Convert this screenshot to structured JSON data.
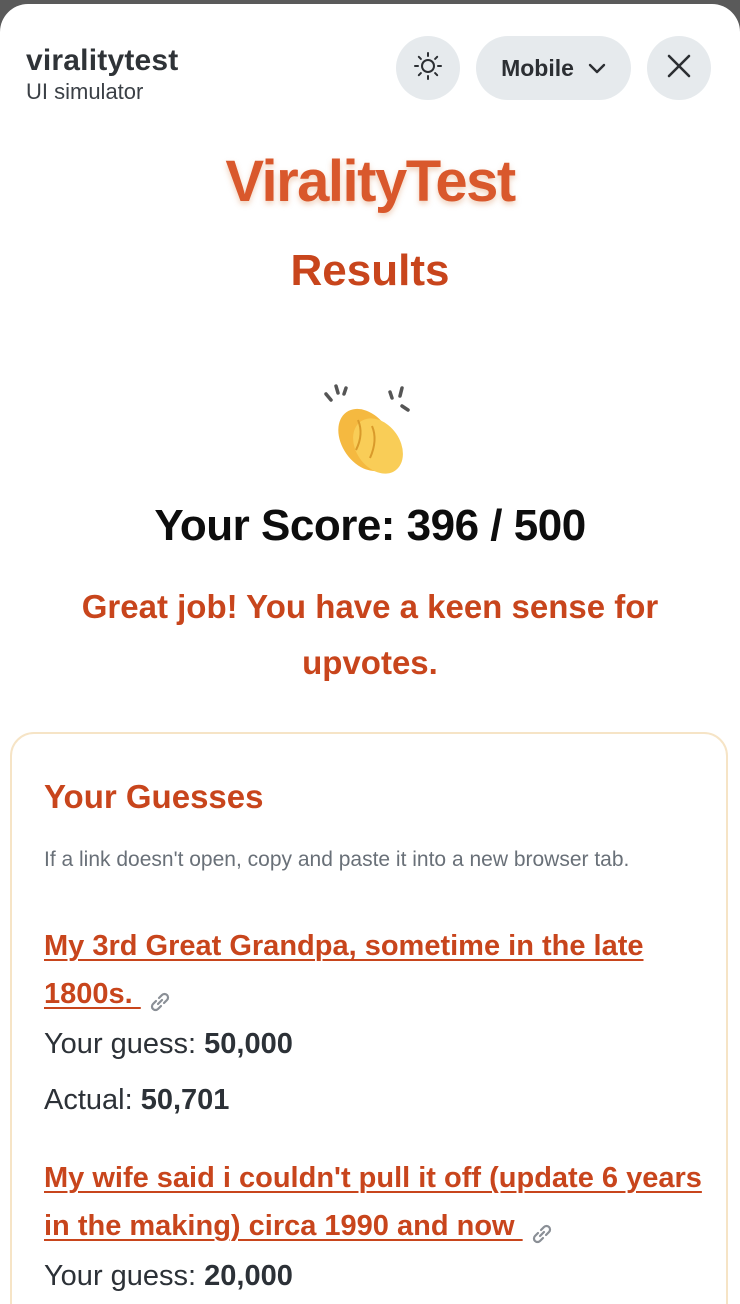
{
  "simulator": {
    "app_name": "viralitytest",
    "subtitle": "UI simulator",
    "mode_label": "Mobile"
  },
  "icons": {
    "theme": "sun-icon",
    "mode_dropdown": "chevron-down-icon",
    "close": "close-icon",
    "celebration": "clapping-hands-icon",
    "link": "link-icon"
  },
  "colors": {
    "brand": "#d9582c",
    "accent": "#c8451c",
    "card_border": "#f6e4c6",
    "control_bg": "#e6eaed"
  },
  "brand": "ViralityTest",
  "results_title": "Results",
  "score_text": "Your Score: 396 / 500",
  "message": "Great job! You have a keen sense for upvotes.",
  "guesses": {
    "title": "Your Guesses",
    "hint": "If a link doesn't open, copy and paste it into a new browser tab.",
    "guess_label": "Your guess: ",
    "actual_label": "Actual: ",
    "items": [
      {
        "post_title": "My 3rd Great Grandpa, sometime in the late 1800s. ",
        "guess": "50,000",
        "actual": "50,701"
      },
      {
        "post_title": "My wife said i couldn't pull it off (update 6 years in the making) circa 1990 and now ",
        "guess": "20,000"
      }
    ]
  }
}
